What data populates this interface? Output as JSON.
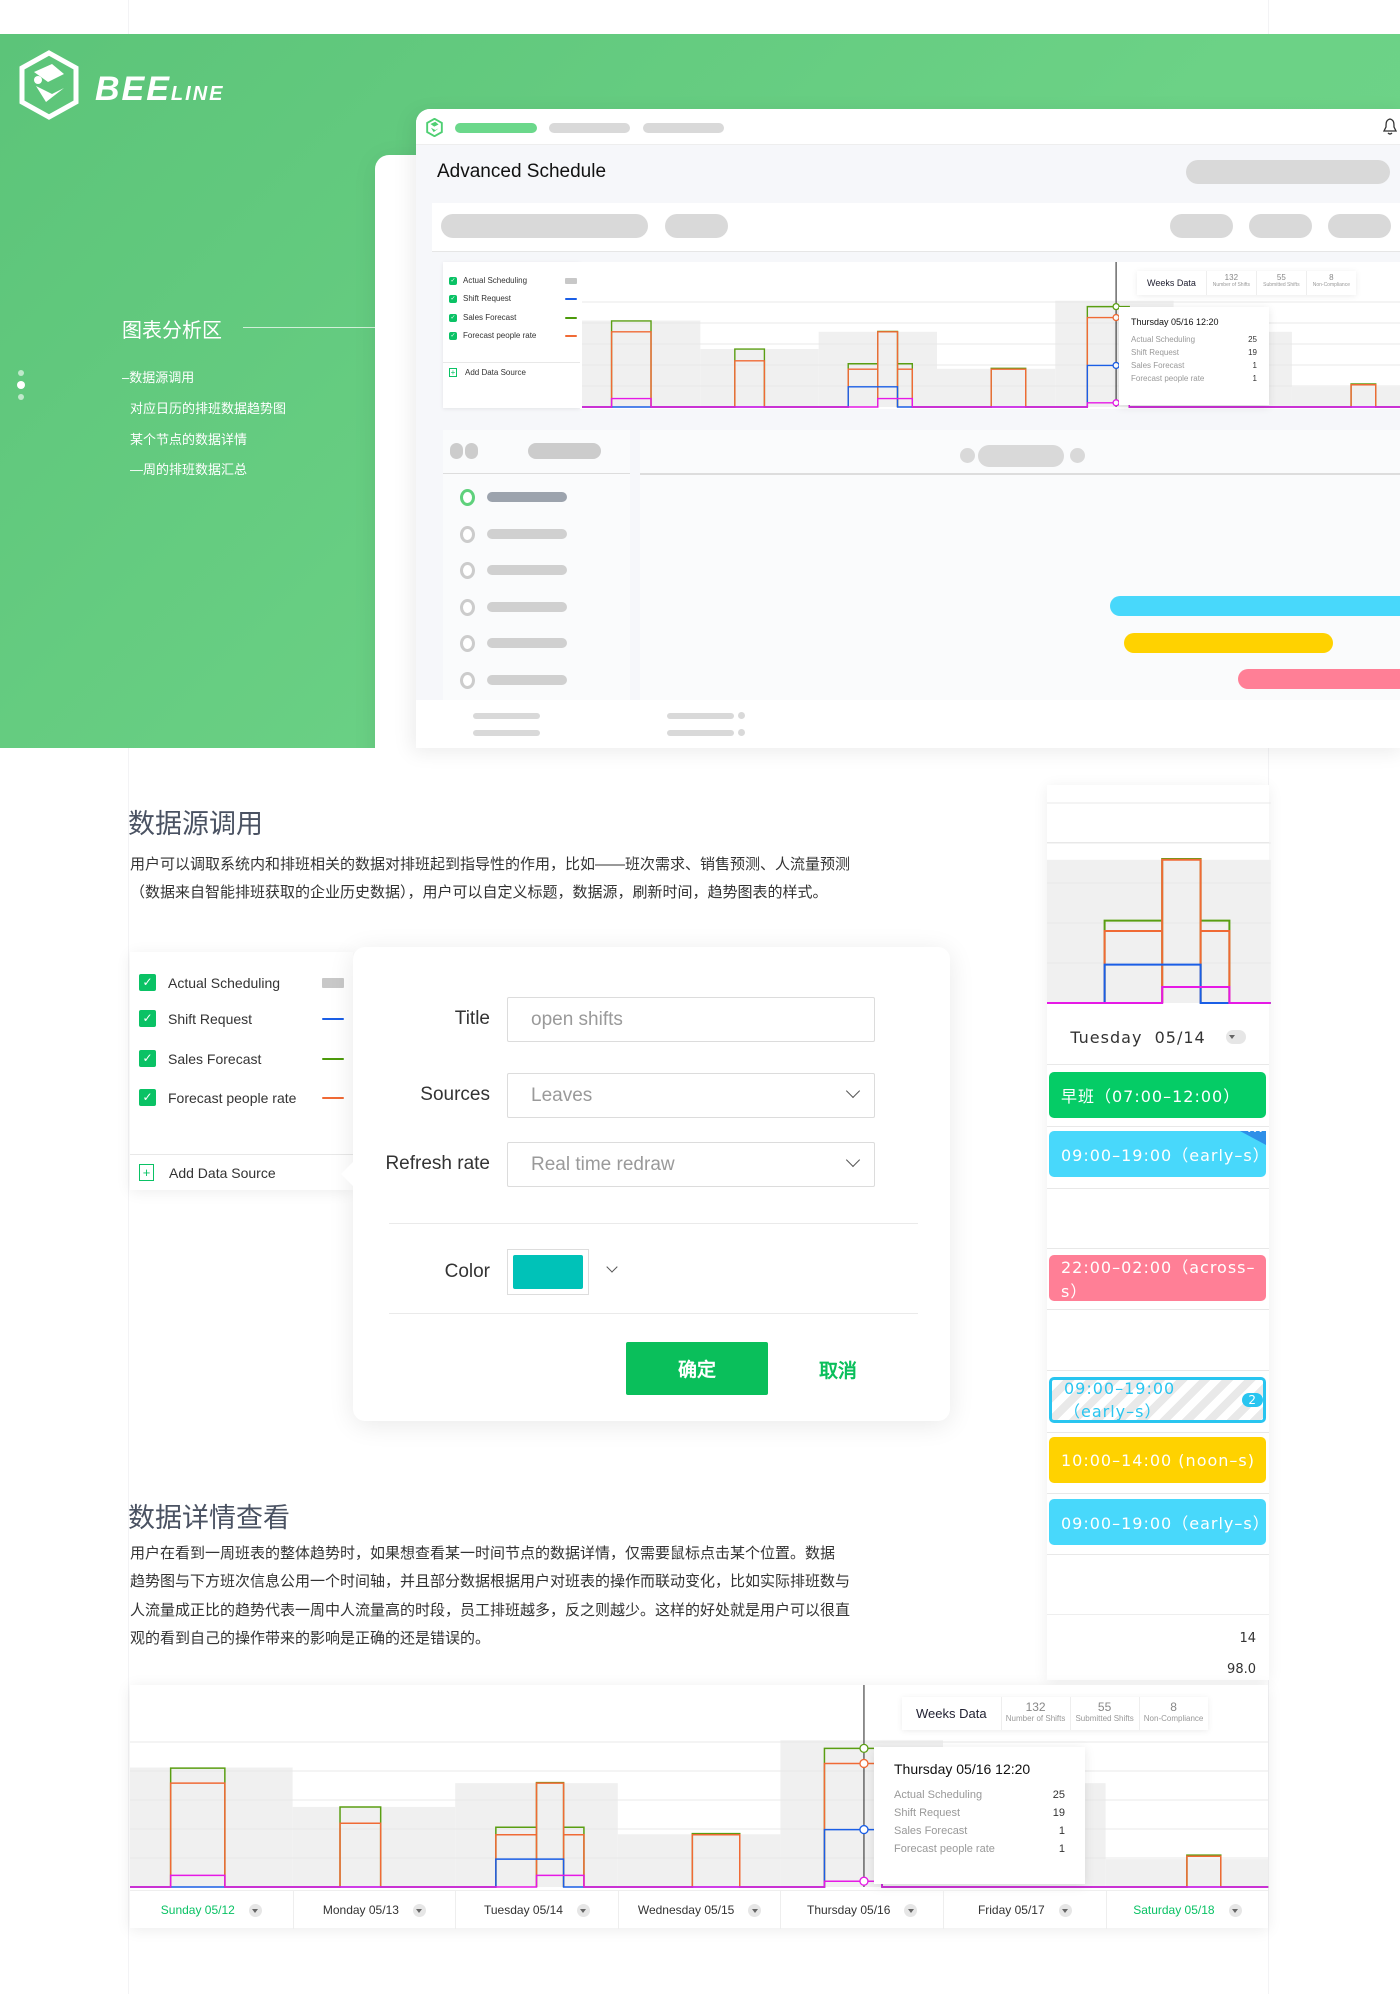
{
  "brand": {
    "name": "BEELINE",
    "name_main": "BEE",
    "name_small": "LINE"
  },
  "hero": {
    "section_title": "图表分析区",
    "items": [
      "–数据源调用",
      "对应日历的排班数据趋势图",
      "某个节点的数据详情",
      "—周的排班数据汇总"
    ],
    "app_title": "Advanced Schedule"
  },
  "legend": {
    "items": [
      {
        "label": "Actual Scheduling",
        "color": "#c8c8c8",
        "checked": true
      },
      {
        "label": "Shift Request",
        "color": "#1a5ee6",
        "checked": true
      },
      {
        "label": "Sales Forecast",
        "color": "#4c9a0a",
        "checked": true
      },
      {
        "label": "Forecast people rate",
        "color": "#f06a35",
        "checked": true
      }
    ],
    "add_label": "Add Data Source"
  },
  "weeks_data": {
    "label": "Weeks Data",
    "stats": [
      {
        "value": "132",
        "label": "Number of Shifts"
      },
      {
        "value": "55",
        "label": "Submitted Shifts"
      },
      {
        "value": "8",
        "label": "Non-Compliance"
      }
    ]
  },
  "tooltip": {
    "title": "Thursday 05/16 12:20",
    "rows": [
      {
        "label": "Actual Scheduling",
        "value": "25"
      },
      {
        "label": "Shift Request",
        "value": "19"
      },
      {
        "label": "Sales Forecast",
        "value": "1"
      },
      {
        "label": "Forecast people rate",
        "value": "1"
      }
    ]
  },
  "section1": {
    "heading": "数据源调用",
    "lines": [
      "用户可以调取系统内和排班相关的数据对排班起到指导性的作用，比如——班次需求、销售预测、人流量预测",
      "（数据来自智能排班获取的企业历史数据），用户可以自定义标题，数据源，刷新时间，趋势图表的样式。"
    ]
  },
  "form": {
    "title_label": "Title",
    "title_placeholder": "open shifts",
    "sources_label": "Sources",
    "sources_value": "Leaves",
    "refresh_label": "Refresh rate",
    "refresh_value": "Real time redraw",
    "color_label": "Color",
    "color_value": "#00c2b8",
    "confirm": "确定",
    "cancel": "取消"
  },
  "section2": {
    "heading": "数据详情查看",
    "lines": [
      "用户在看到一周班表的整体趋势时，如果想查看某一时间节点的数据详情，仅需要鼠标点击某个位置。数据",
      "趋势图与下方班次信息公用一个时间轴，并且部分数据根据用户对班表的操作而联动变化，比如实际排班数与",
      "人流量成正比的趋势代表一周中人流量高的时段，员工排班越多，反之则越少。这样的好处就是用户可以很直",
      "观的看到自己的操作带来的影响是正确的还是错误的。"
    ]
  },
  "day_panel": {
    "day_label": "Tuesday  05/14",
    "shifts": [
      {
        "label": "早班（07:00–12:00）",
        "color": "#05cc66",
        "style": "solid"
      },
      {
        "label": "09:00–19:00（early–s）",
        "color": "#48d8fb",
        "style": "solid",
        "more": "•••"
      },
      {
        "label": "22:00–02:00（across–s）",
        "color": "#ff7f96",
        "style": "solid"
      },
      {
        "label": "09:00–19:00（early–s）",
        "color": "#29c5f0",
        "style": "striped",
        "badge": "2"
      },
      {
        "label": "10:00–14:00 (noon–s)",
        "color": "#ffd200",
        "style": "solid"
      },
      {
        "label": "09:00–19:00（early–s）",
        "color": "#48d8fb",
        "style": "solid"
      }
    ],
    "stat1": "14",
    "stat2": "98.0"
  },
  "days": [
    {
      "label": "Sunday 05/12",
      "weekend": true
    },
    {
      "label": "Monday 05/13",
      "weekend": false
    },
    {
      "label": "Tuesday 05/14",
      "weekend": false
    },
    {
      "label": "Wednesday 05/15",
      "weekend": false
    },
    {
      "label": "Thursday 05/16",
      "weekend": false
    },
    {
      "label": "Friday 05/17",
      "weekend": false
    },
    {
      "label": "Saturday 05/18",
      "weekend": true
    }
  ],
  "chart_data": {
    "type": "line",
    "step": true,
    "x_range": [
      "05/12 00:00",
      "05/19 00:00"
    ],
    "ylim": [
      0,
      30
    ],
    "grid": true,
    "cursor": "05/16 12:20",
    "series": [
      {
        "name": "Actual Scheduling",
        "color": "#f0f0f0",
        "kind": "area",
        "segments": [
          [
            "05/12 00:00",
            "05/13 00:00",
            20.6
          ],
          [
            "05/13 00:00",
            "05/14 00:00",
            13.8
          ],
          [
            "05/14 00:00",
            "05/15 00:00",
            17.9
          ],
          [
            "05/15 00:00",
            "05/16 00:00",
            9.1
          ],
          [
            "05/16 00:00",
            "05/17 00:00",
            25.3
          ],
          [
            "05/17 00:00",
            "05/18 00:00",
            17.9
          ],
          [
            "05/18 00:00",
            "05/19 00:00",
            4.8
          ]
        ]
      },
      {
        "name": "Sales Forecast",
        "color": "#5a9e12",
        "kind": "line",
        "segments": [
          [
            "05/12 06:00",
            "05/12 14:00",
            20.5
          ],
          [
            "05/13 07:00",
            "05/13 13:00",
            13.8
          ],
          [
            "05/14 06:00",
            "05/14 12:00",
            10.3
          ],
          [
            "05/14 12:00",
            "05/14 16:00",
            18
          ],
          [
            "05/14 16:00",
            "05/14 19:00",
            10.3
          ],
          [
            "05/15 11:00",
            "05/15 18:00",
            9.2
          ],
          [
            "05/16 06:30",
            "05/16 15:00",
            23.9
          ],
          [
            "05/18 12:00",
            "05/18 17:00",
            5.5
          ]
        ]
      },
      {
        "name": "Forecast people rate",
        "color": "#f06a35",
        "kind": "line",
        "segments": [
          [
            "05/12 06:00",
            "05/12 14:00",
            17.9
          ],
          [
            "05/13 07:00",
            "05/13 13:00",
            11
          ],
          [
            "05/14 06:00",
            "05/14 12:00",
            9
          ],
          [
            "05/14 12:00",
            "05/14 16:00",
            17.9
          ],
          [
            "05/14 16:00",
            "05/14 19:00",
            9
          ],
          [
            "05/15 11:00",
            "05/15 18:00",
            9
          ],
          [
            "05/16 06:30",
            "05/16 15:00",
            21.3
          ],
          [
            "05/18 12:00",
            "05/18 17:00",
            5.3
          ]
        ]
      },
      {
        "name": "Shift Request",
        "color": "#1a5ee6",
        "kind": "line",
        "segments": [
          [
            "05/14 06:00",
            "05/14 16:00",
            4.8
          ],
          [
            "05/16 06:30",
            "05/16 15:00",
            9.9
          ]
        ]
      },
      {
        "name": "",
        "color": "#e619e6",
        "kind": "line",
        "segments": [
          [
            "05/12 06:00",
            "05/12 14:00",
            2
          ],
          [
            "05/14 12:00",
            "05/14 19:00",
            2
          ],
          [
            "05/16 06:30",
            "05/16 15:00",
            1
          ]
        ]
      }
    ]
  }
}
